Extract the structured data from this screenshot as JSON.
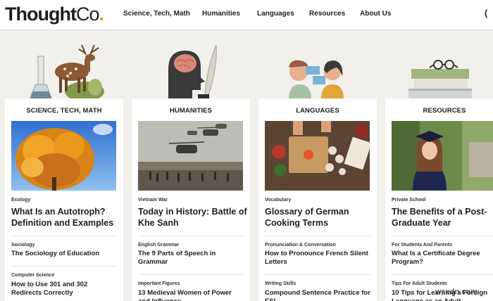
{
  "header": {
    "logo": {
      "thought": "Thought",
      "co": "Co",
      "dot": "."
    },
    "nav": [
      "Science, Tech, Math",
      "Humanities",
      "Languages",
      "Resources",
      "About Us"
    ]
  },
  "columns": [
    {
      "title": "SCIENCE, TECH, MATH",
      "featured": {
        "category": "Ecology",
        "title": "What Is an Autotroph? Definition and Examples"
      },
      "items": [
        {
          "category": "Sociology",
          "title": "The Sociology of Education"
        },
        {
          "category": "Computer Science",
          "title": "How to Use 301 and 302 Redirects Correctly"
        }
      ]
    },
    {
      "title": "HUMANITIES",
      "featured": {
        "category": "Vietnam War",
        "title": "Today in History: Battle of Khe Sanh"
      },
      "items": [
        {
          "category": "English Grammar",
          "title": "The 9 Parts of Speech in Grammar"
        },
        {
          "category": "Important Figures",
          "title": "13 Medieval Women of Power and Influence"
        }
      ]
    },
    {
      "title": "LANGUAGES",
      "featured": {
        "category": "Vocabulary",
        "title": "Glossary of German Cooking Terms"
      },
      "items": [
        {
          "category": "Pronunciation & Conversation",
          "title": "How to Pronounce French Silent Letters"
        },
        {
          "category": "Writing Skills",
          "title": "Compound Sentence Practice for ESL"
        }
      ]
    },
    {
      "title": "RESOURCES",
      "featured": {
        "category": "Private School",
        "title": "The Benefits of a Post-Graduate Year"
      },
      "items": [
        {
          "category": "For Students And Parents",
          "title": "What Is a Certificate Degree Program?"
        },
        {
          "category": "Tips For Adult Students",
          "title": "10 Tips for Learning a Foreign Language as an Adult"
        }
      ]
    }
  ],
  "watermark": "wsxdn.com",
  "colors": {
    "background": "#f1f0eb",
    "card": "#ffffff",
    "logo_dot": "#e0a32e",
    "text": "#1e1e1e"
  }
}
